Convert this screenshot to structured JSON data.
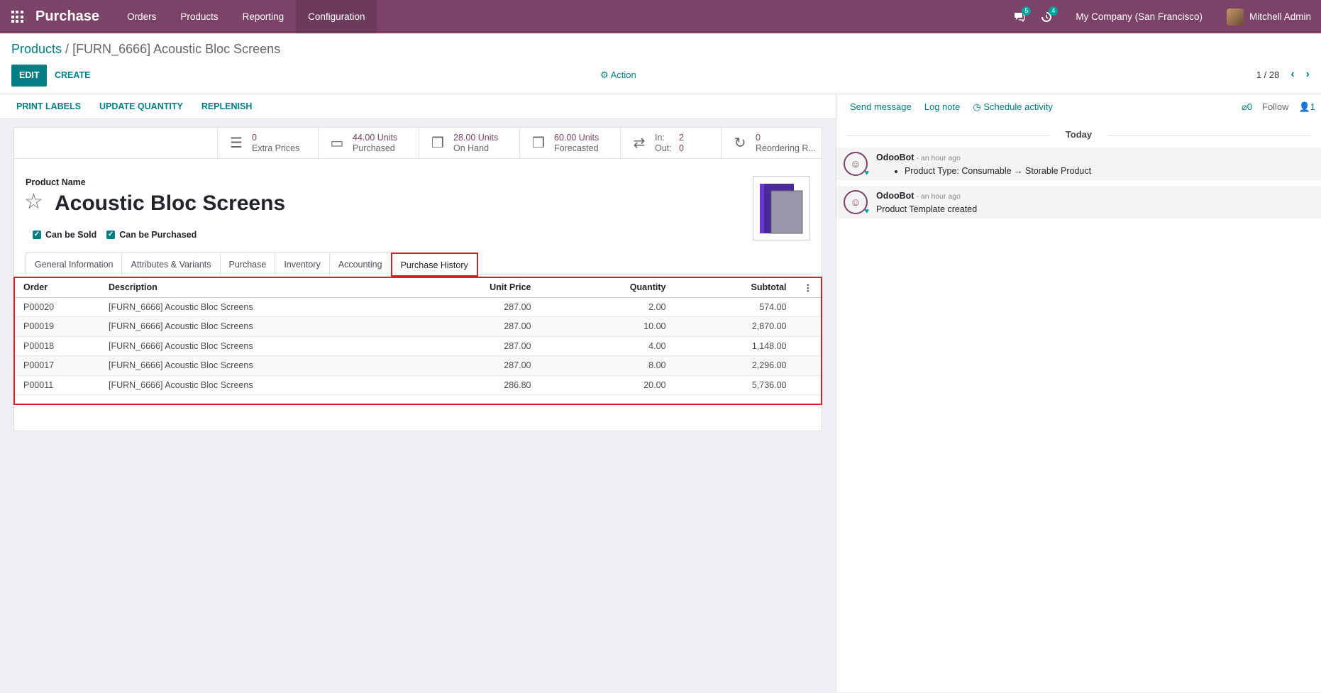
{
  "nav": {
    "brand": "Purchase",
    "menu": [
      "Orders",
      "Products",
      "Reporting",
      "Configuration"
    ],
    "messages_badge": "5",
    "activities_badge": "4",
    "company": "My Company (San Francisco)",
    "user": "Mitchell Admin"
  },
  "breadcrumb": {
    "parent": "Products",
    "separator": " / ",
    "current": "[FURN_6666] Acoustic Bloc Screens"
  },
  "buttons": {
    "edit": "EDIT",
    "create": "CREATE",
    "action": "Action"
  },
  "pager": {
    "value": "1 / 28"
  },
  "status_buttons": [
    "PRINT LABELS",
    "UPDATE QUANTITY",
    "REPLENISH"
  ],
  "smart_buttons": {
    "extra_prices": {
      "value": "0",
      "label": "Extra Prices"
    },
    "purchased": {
      "value": "44.00 Units",
      "label": "Purchased"
    },
    "on_hand": {
      "value": "28.00 Units",
      "label": "On Hand"
    },
    "forecasted": {
      "value": "60.00 Units",
      "label": "Forecasted"
    },
    "in_out": {
      "in_label": "In:",
      "in_value": "2",
      "out_label": "Out:",
      "out_value": "0"
    },
    "reordering": {
      "value": "0",
      "label": "Reordering R..."
    }
  },
  "product": {
    "name_label": "Product Name",
    "name": "Acoustic Bloc Screens",
    "can_be_sold": "Can be Sold",
    "can_be_purchased": "Can be Purchased"
  },
  "tabs": [
    "General Information",
    "Attributes & Variants",
    "Purchase",
    "Inventory",
    "Accounting",
    "Purchase History"
  ],
  "history": {
    "columns": [
      "Order",
      "Description",
      "Unit Price",
      "Quantity",
      "Subtotal"
    ],
    "rows": [
      [
        "P00020",
        "[FURN_6666] Acoustic Bloc Screens",
        "287.00",
        "2.00",
        "574.00"
      ],
      [
        "P00019",
        "[FURN_6666] Acoustic Bloc Screens",
        "287.00",
        "10.00",
        "2,870.00"
      ],
      [
        "P00018",
        "[FURN_6666] Acoustic Bloc Screens",
        "287.00",
        "4.00",
        "1,148.00"
      ],
      [
        "P00017",
        "[FURN_6666] Acoustic Bloc Screens",
        "287.00",
        "8.00",
        "2,296.00"
      ],
      [
        "P00011",
        "[FURN_6666] Acoustic Bloc Screens",
        "286.80",
        "20.00",
        "5,736.00"
      ]
    ]
  },
  "chatter": {
    "send_message": "Send message",
    "log_note": "Log note",
    "schedule_activity": "Schedule activity",
    "attachments": "0",
    "follow": "Follow",
    "followers": "1",
    "date_separator": "Today",
    "messages": [
      {
        "author": "OdooBot",
        "when": "- an hour ago",
        "body": "Product Type: Consumable → Storable Product"
      },
      {
        "author": "OdooBot",
        "when": "- an hour ago",
        "body": "Product Template created"
      }
    ]
  }
}
